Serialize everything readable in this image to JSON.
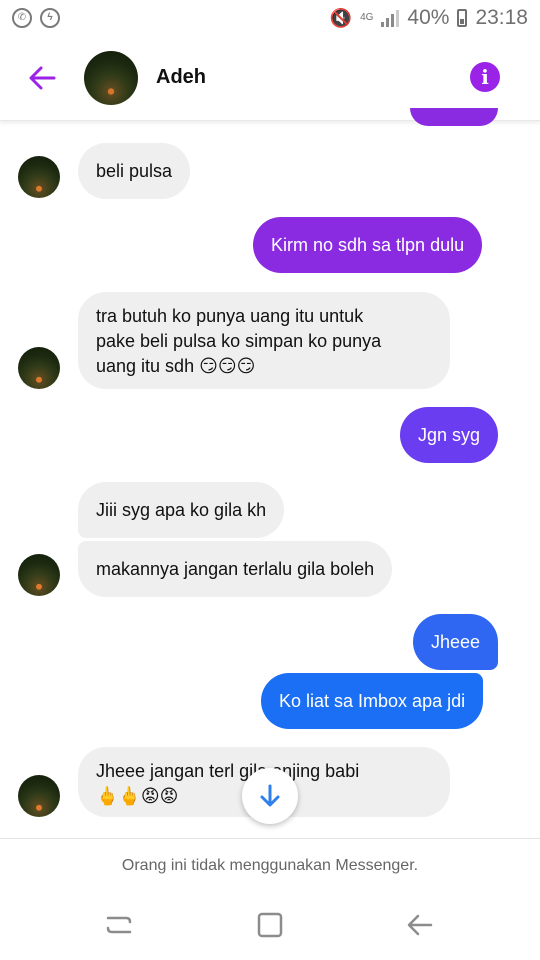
{
  "status_bar": {
    "left_icons": [
      "whatsapp-icon",
      "messenger-icon"
    ],
    "network": "4G",
    "battery": "40%",
    "time": "23:18"
  },
  "header": {
    "contact_name": "Adeh",
    "info_glyph": "i"
  },
  "messages": [
    {
      "side": "in",
      "text": "beli pulsa"
    },
    {
      "side": "out",
      "text": "Kirm no sdh sa tlpn dulu",
      "color": "#8a2be2"
    },
    {
      "side": "in",
      "lines": [
        "tra butuh ko punya uang itu untuk",
        "pake beli pulsa ko simpan ko punya",
        "uang itu sdh 😏😏😏"
      ]
    },
    {
      "side": "out",
      "text": "Jgn syg",
      "color": "#6a3df0"
    },
    {
      "side": "in",
      "text": "Jiii syg apa ko gila kh"
    },
    {
      "side": "in",
      "text": "makannya jangan terlalu gila boleh"
    },
    {
      "side": "out",
      "text": "Jheee",
      "color": "#2f66f2"
    },
    {
      "side": "out",
      "text": "Ko liat sa Imbox apa jdi",
      "color": "#1a6ff5"
    },
    {
      "side": "in",
      "lines": [
        "Jheee jangan terl   gila anjing babi",
        "🖕🖕😡😡"
      ]
    }
  ],
  "footer": {
    "notice": "Orang ini tidak menggunakan Messenger."
  },
  "colors": {
    "accent": "#9b23e8",
    "incoming_bubble": "#efefef"
  }
}
